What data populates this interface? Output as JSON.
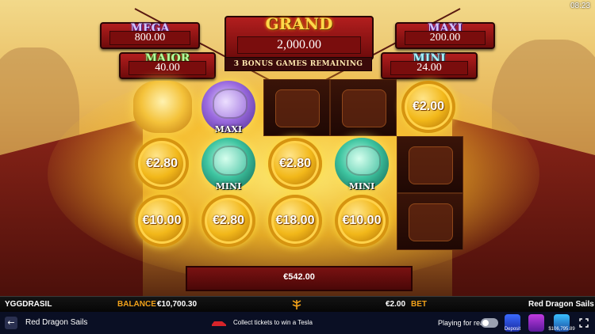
{
  "game": {
    "jackpots": {
      "mega": {
        "label": "MEGA",
        "value": "800.00"
      },
      "grand": {
        "label": "GRAND",
        "value": "2,000.00"
      },
      "maxi": {
        "label": "MAXI",
        "value": "200.00"
      },
      "major": {
        "label": "MAJOR",
        "value": "40.00"
      },
      "mini": {
        "label": "MINI",
        "value": "24.00"
      }
    },
    "bonus_banner": "3 BONUS GAMES REMAINING",
    "grid": {
      "row1": [
        "dragon",
        "maxi",
        "dark",
        "dark",
        "€2.00"
      ],
      "row2": [
        "€2.80",
        "mini",
        "€2.80",
        "mini",
        "dark"
      ],
      "row3": [
        "€10.00",
        "€2.80",
        "€18.00",
        "€10.00",
        "dark"
      ],
      "orb_labels": {
        "maxi": "MAXI",
        "mini": "MINI"
      }
    },
    "total_win": "€542.00",
    "clock": "08:23"
  },
  "hud": {
    "provider": "YGGDRASIL",
    "balance_label": "BALANCE",
    "balance_value": "€10,700.30",
    "bet_value": "€2.00",
    "bet_label": "BET",
    "game_name": "Red Dragon Sails"
  },
  "footer": {
    "back_icon": "arrow-left",
    "title": "Red Dragon Sails",
    "promo_text": "Collect tickets to win a Tesla",
    "play_for_real": "Playing for real",
    "promo_amount": "$106,795.89",
    "promo_badge_1": "Deposit",
    "colors": {
      "bg": "#0a0f24",
      "toggle": "#9aa0b0"
    }
  }
}
